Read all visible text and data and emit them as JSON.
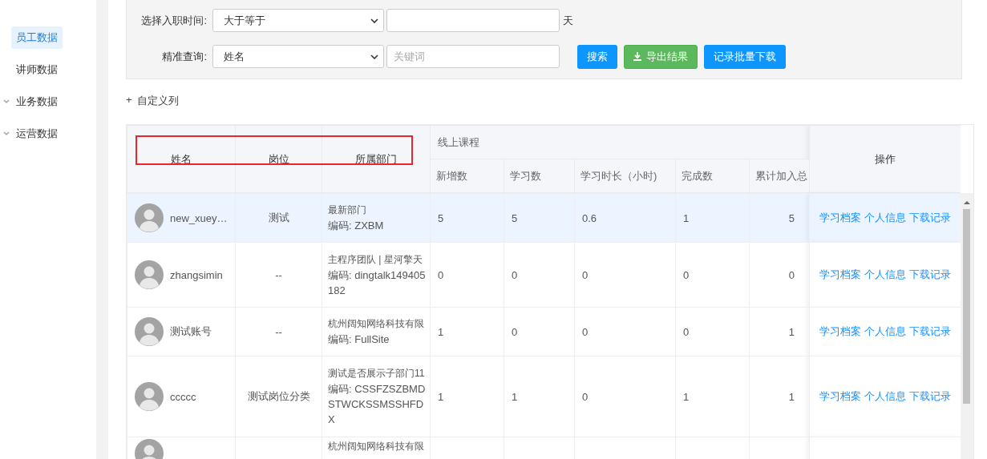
{
  "sidebar": {
    "items": [
      {
        "label": "员工数据",
        "selected": true,
        "has_children": false
      },
      {
        "label": "讲师数据",
        "selected": false,
        "has_children": false
      },
      {
        "label": "业务数据",
        "selected": false,
        "has_children": true
      },
      {
        "label": "运营数据",
        "selected": false,
        "has_children": true
      }
    ]
  },
  "filters": {
    "hire_time": {
      "label": "选择入职时间:",
      "operator": "大于等于",
      "unit": "天"
    },
    "exact_query": {
      "label": "精准查询:",
      "field": "姓名",
      "placeholder": "关键词"
    },
    "buttons": [
      {
        "label": "搜索",
        "kind": "primary"
      },
      {
        "label": "导出结果",
        "kind": "export"
      },
      {
        "label": "记录批量下载",
        "kind": "primary"
      }
    ]
  },
  "custom_columns": {
    "icon": "+",
    "label": "自定义列"
  },
  "table": {
    "fixed_columns": [
      "姓名",
      "岗位",
      "所属部门"
    ],
    "group_header": "线上课程",
    "course_columns": [
      "新增数",
      "学习数",
      "学习时长（小时)",
      "完成数",
      "累计加入总"
    ],
    "action_header": "操作",
    "rows": [
      {
        "selected": true,
        "name": "new_xuey…",
        "position": "测试",
        "department": [
          "最新部门",
          "编码: ZXBM"
        ],
        "values": [
          "5",
          "5",
          "0.6",
          "1",
          "5"
        ],
        "actions": [
          "学习档案",
          "个人信息",
          "下载记录"
        ]
      },
      {
        "selected": false,
        "name": "zhangsimin",
        "position": "--",
        "department": [
          "主程序团队 | 星河擎天",
          "编码: dingtalk149405182"
        ],
        "values": [
          "0",
          "0",
          "0",
          "0",
          "0"
        ],
        "actions": [
          "学习档案",
          "个人信息",
          "下载记录"
        ]
      },
      {
        "selected": false,
        "name": "测试账号",
        "position": "--",
        "department": [
          "杭州阔知网络科技有限",
          "编码: FullSite"
        ],
        "values": [
          "1",
          "0",
          "0",
          "0",
          "1"
        ],
        "actions": [
          "学习档案",
          "个人信息",
          "下载记录"
        ]
      },
      {
        "selected": false,
        "name": "ccccc",
        "position": "测试岗位分类",
        "department": [
          "测试是否展示子部门11",
          "编码: CSSFZSZBMDSTWCKSSMSSHFDX"
        ],
        "values": [
          "1",
          "1",
          "0",
          "1",
          "1"
        ],
        "actions": [
          "学习档案",
          "个人信息",
          "下载记录"
        ]
      },
      {
        "selected": false,
        "department": [
          "杭州阔知网络科技有限"
        ]
      }
    ]
  }
}
